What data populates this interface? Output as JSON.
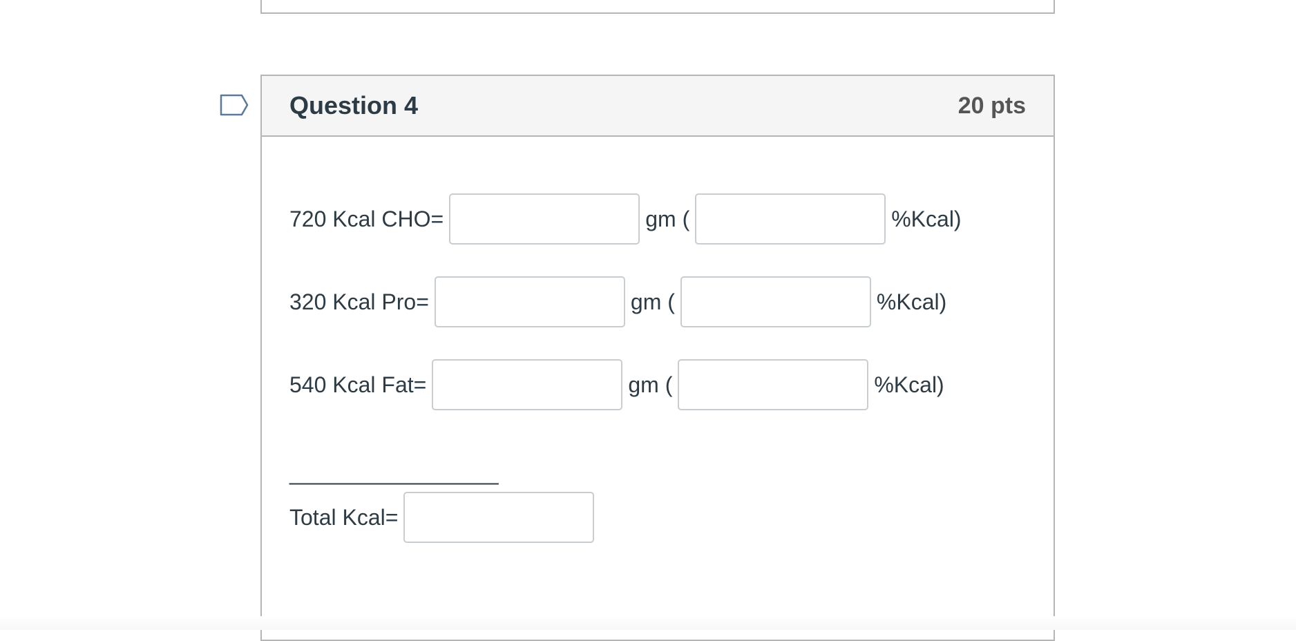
{
  "question": {
    "title": "Question 4",
    "points": "20 pts",
    "rows": [
      {
        "label": "720 Kcal CHO=",
        "unit1": "gm (",
        "unit2": "%Kcal)"
      },
      {
        "label": "320 Kcal Pro=",
        "unit1": "gm (",
        "unit2": "%Kcal)"
      },
      {
        "label": "540 Kcal Fat=",
        "unit1": "gm (",
        "unit2": "%Kcal)"
      }
    ],
    "separator": "_________________",
    "total_label": "Total Kcal="
  },
  "icons": {
    "flag": "flag-question-icon"
  },
  "colors": {
    "header_bg": "#f5f5f5",
    "border": "#b5b5b5",
    "text": "#2d3b45",
    "flag": "#5b7a99"
  }
}
